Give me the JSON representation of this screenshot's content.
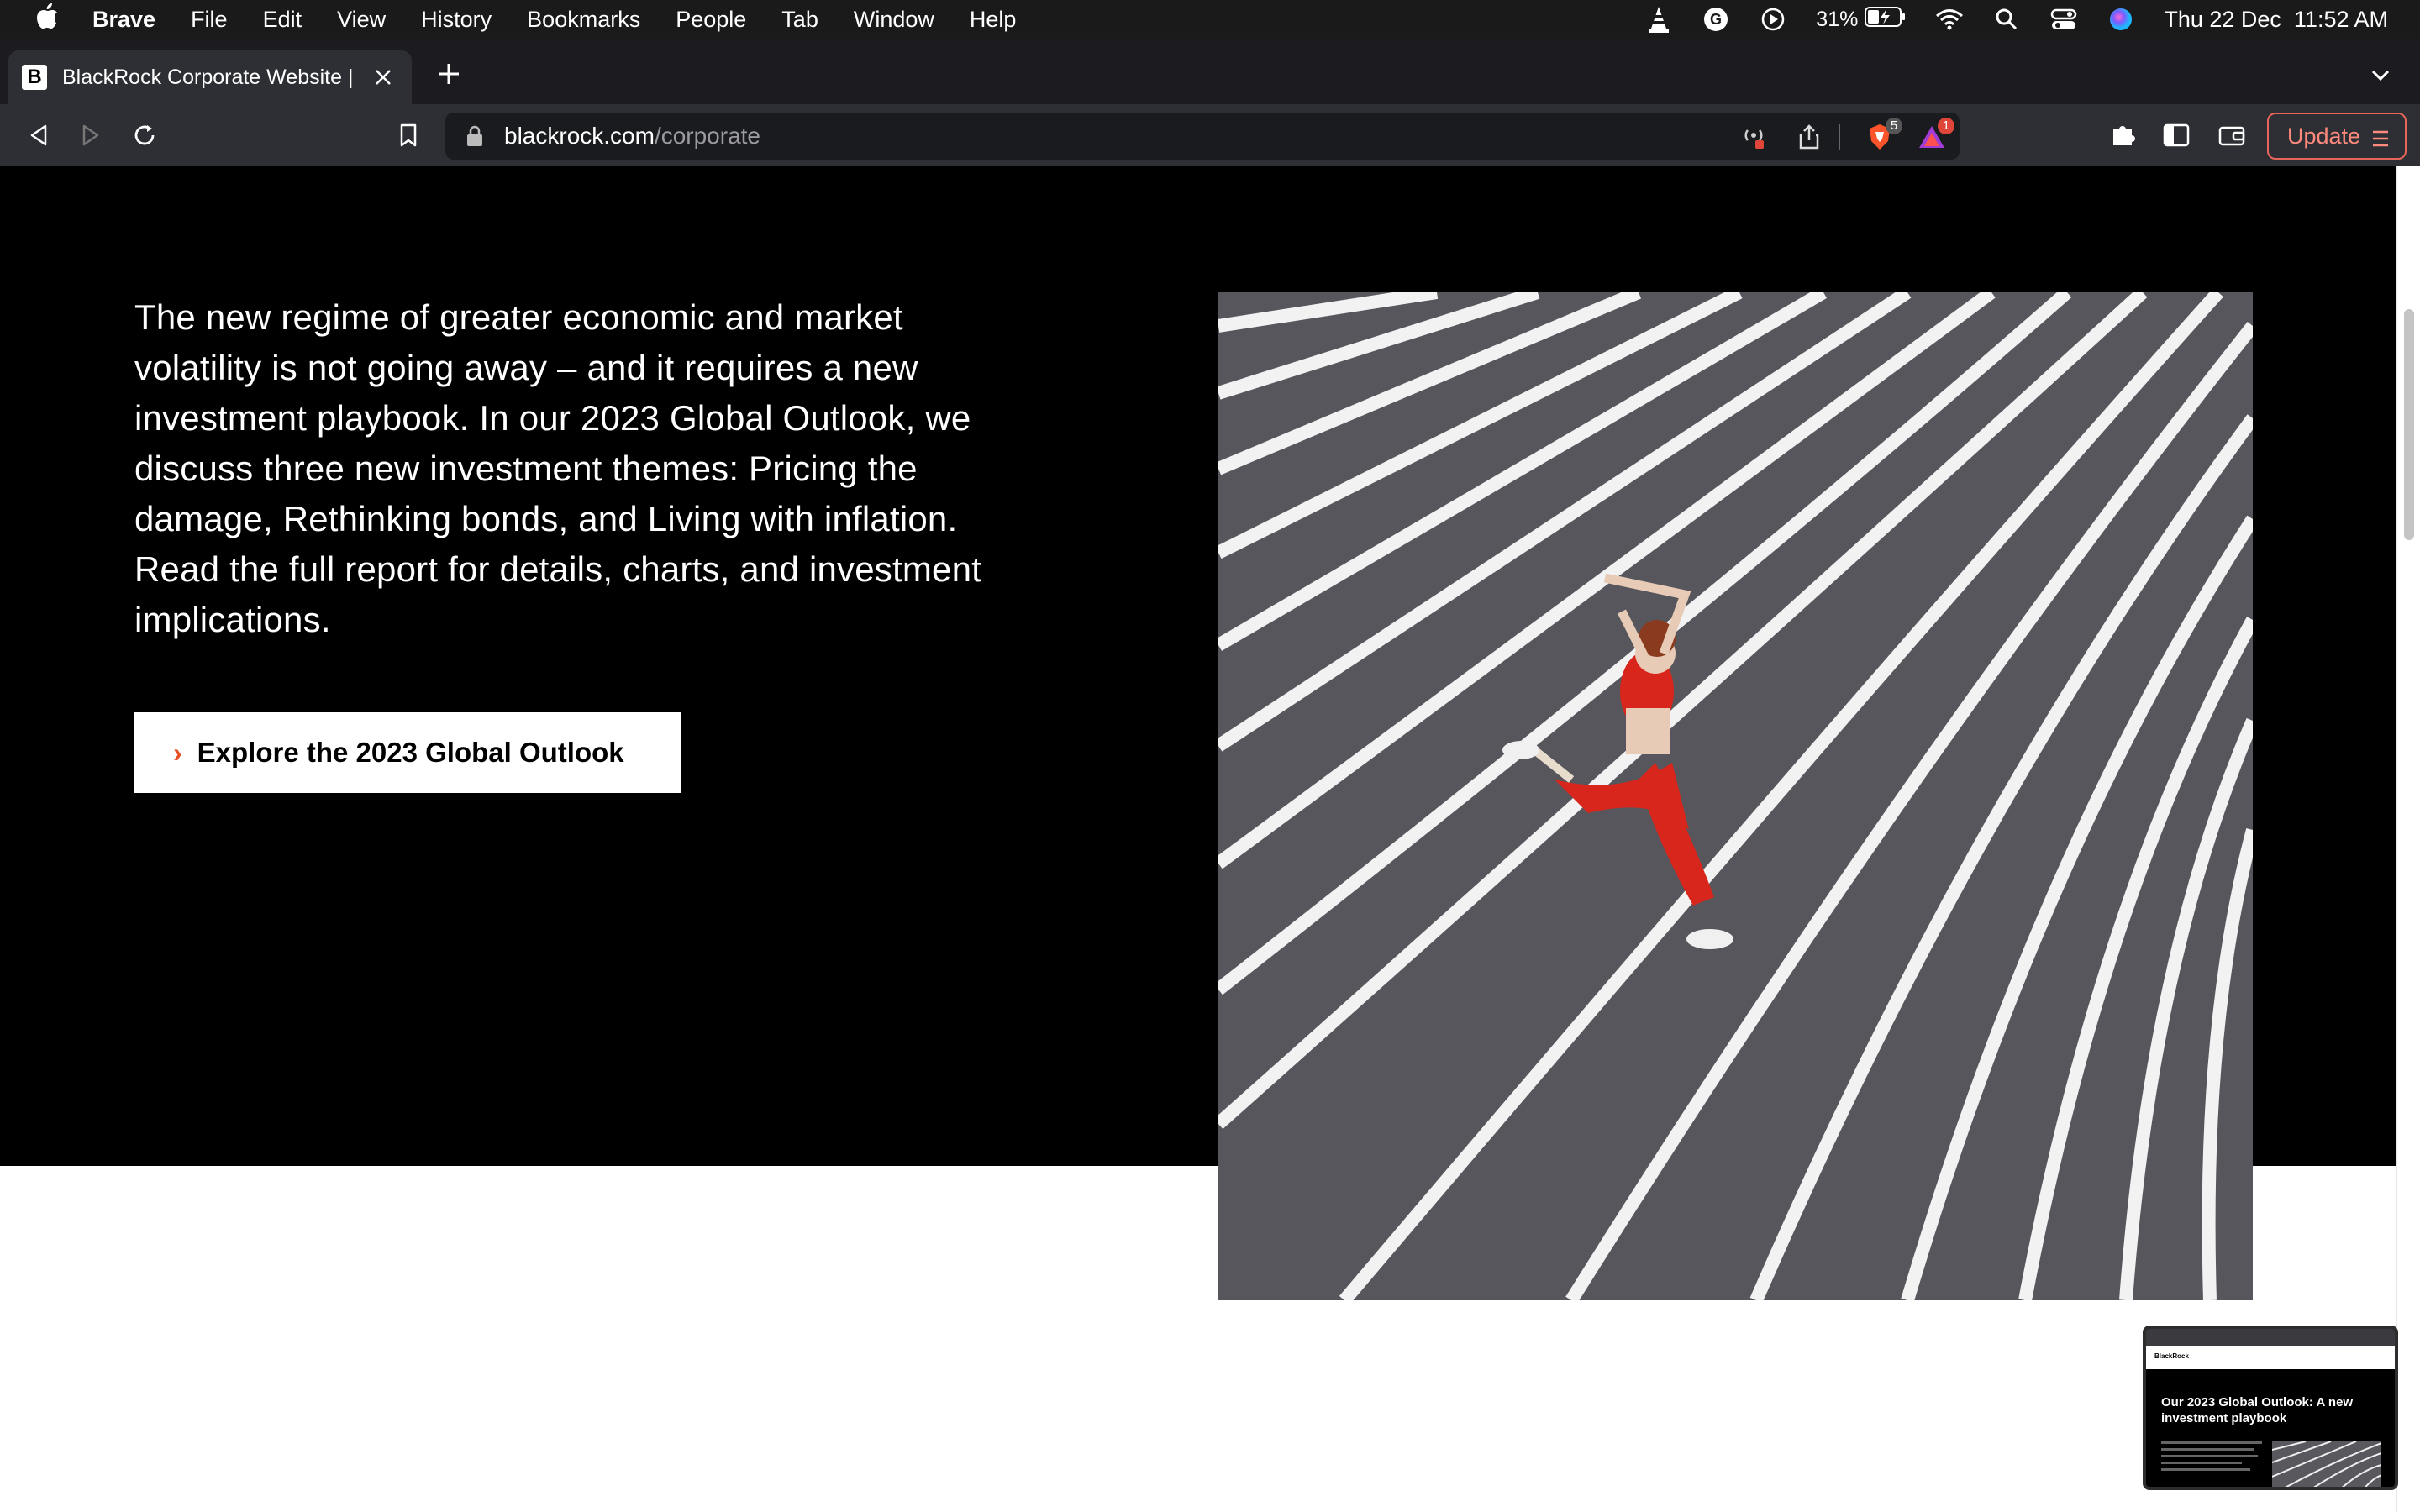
{
  "menubar": {
    "app_name": "Brave",
    "items": [
      "File",
      "Edit",
      "View",
      "History",
      "Bookmarks",
      "People",
      "Tab",
      "Window",
      "Help"
    ],
    "battery": "31%",
    "datetime": "Thu 22 Dec  11:52 AM"
  },
  "tab": {
    "title": "BlackRock Corporate Website |",
    "favicon_letter": "B"
  },
  "toolbar": {
    "url_domain": "blackrock.com",
    "url_path": "/corporate",
    "shields_badge": "5",
    "rewards_badge": "1",
    "update_label": "Update"
  },
  "hero": {
    "paragraph": "The new regime of greater economic and market volatility is not going away – and it requires a new investment playbook. In our 2023 Global Outlook, we discuss three new investment themes: Pricing the damage, Rethinking bonds, and Living with inflation. Read the full report for details, charts, and investment implications.",
    "cta_label": "Explore the 2023 Global Outlook",
    "cta_chevron": "›"
  },
  "preview": {
    "logo": "BlackRock",
    "title": "Our 2023 Global Outlook: A new investment playbook"
  },
  "colors": {
    "accent": "#e84f25",
    "update_border": "#e8655a",
    "hero_bg": "#000000"
  }
}
